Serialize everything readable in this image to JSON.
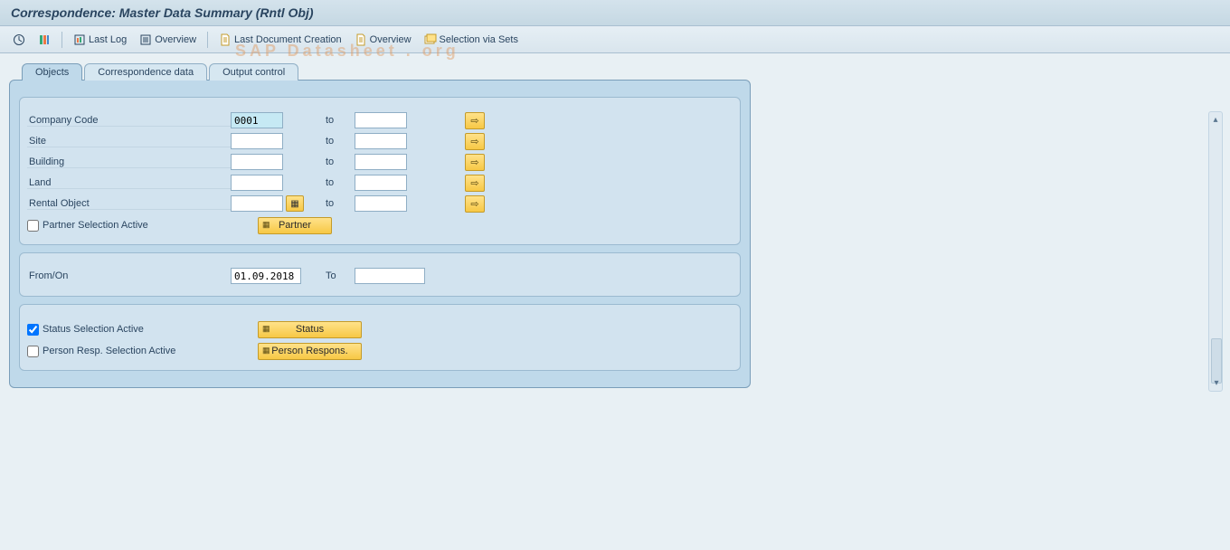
{
  "title": "Correspondence: Master Data Summary (Rntl Obj)",
  "toolbar": {
    "execute_icon": "execute",
    "variant_icon": "variant",
    "last_log": "Last Log",
    "overview1": "Overview",
    "last_doc_creation": "Last Document Creation",
    "overview2": "Overview",
    "selection_via_sets": "Selection via Sets"
  },
  "tabs": {
    "objects": "Objects",
    "correspondence_data": "Correspondence data",
    "output_control": "Output control"
  },
  "section1": {
    "company_code": {
      "label": "Company Code",
      "from": "0001",
      "to_label": "to",
      "to": ""
    },
    "site": {
      "label": "Site",
      "from": "",
      "to_label": "to",
      "to": ""
    },
    "building": {
      "label": "Building",
      "from": "",
      "to_label": "to",
      "to": ""
    },
    "land": {
      "label": "Land",
      "from": "",
      "to_label": "to",
      "to": ""
    },
    "rental_object": {
      "label": "Rental Object",
      "from": "",
      "to_label": "to",
      "to": ""
    },
    "partner_sel_active": "Partner Selection Active",
    "partner_btn": "Partner"
  },
  "section2": {
    "from_on": {
      "label": "From/On",
      "value": "01.09.2018"
    },
    "to_label": "To"
  },
  "section3": {
    "status_sel_active": "Status Selection Active",
    "status_btn": "Status",
    "person_resp_sel_active": "Person Resp. Selection Active",
    "person_respons_btn": "Person Respons."
  },
  "checkbox_states": {
    "partner": false,
    "status": true,
    "person_resp": false
  },
  "watermark": "SAP Datasheet . org"
}
